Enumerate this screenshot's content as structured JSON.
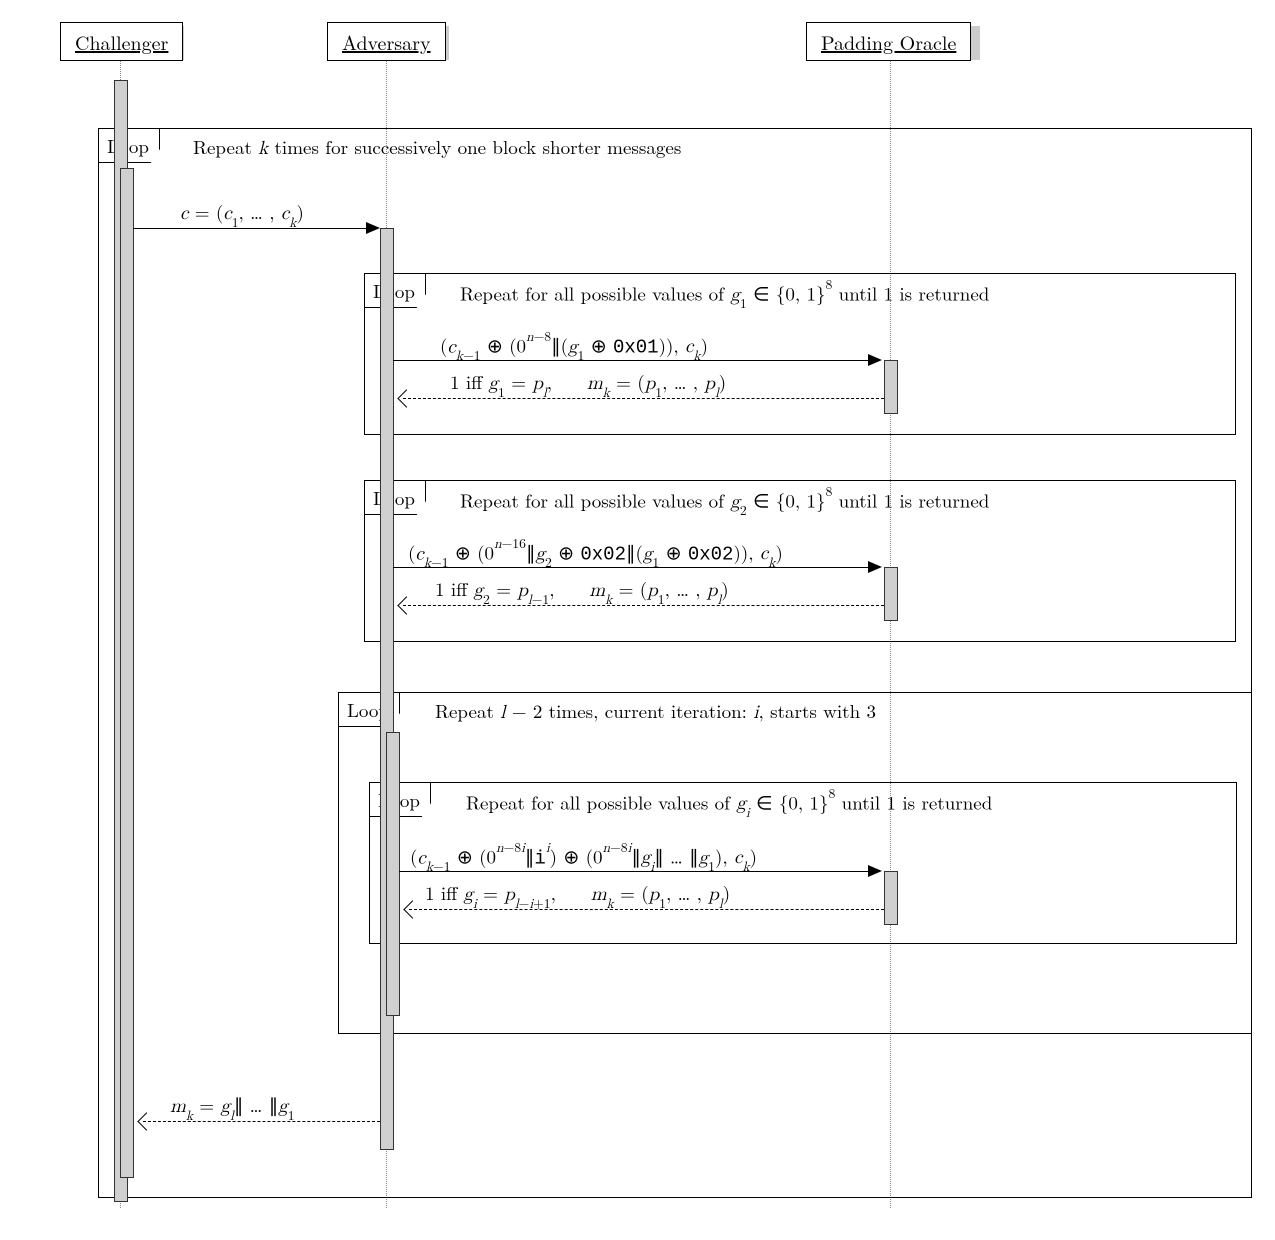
{
  "participants": {
    "challenger": "Challenger",
    "adversary": "Adversary",
    "oracle": "Padding Oracle"
  },
  "loops": {
    "outer": {
      "label": "Loop",
      "caption": "Repeat <span class='math'>k</span> times for successively one block shorter messages"
    },
    "g1": {
      "label": "Loop",
      "caption": "Repeat for all possible values of <span class='math'>g</span><sub>1</sub> ∈ {0, 1}<sup>8</sup> until 1 is returned"
    },
    "g2": {
      "label": "Loop",
      "caption": "Repeat for all possible values of <span class='math'>g</span><sub>2</sub> ∈ {0, 1}<sup>8</sup> until 1 is returned"
    },
    "lminus2": {
      "label": "Loop",
      "caption": "Repeat <span class='math'>l</span> − 2 times, current iteration: <span class='math'>i</span>, starts with 3"
    },
    "gi": {
      "label": "Loop",
      "caption": "Repeat for all possible values of <span class='math'>g<sub>i</sub></span> ∈ {0, 1}<sup>8</sup> until 1 is returned"
    }
  },
  "messages": {
    "ciphertext": "<span class='math'>c</span> = (<span class='math'>c</span><sub>1</sub>, … , <span class='math'>c<sub>k</sub></span>)",
    "g1_send": "(<span class='math'>c</span><sub><span class='math'>k</span>−1</sub> ⊕ (0<sup><span class='math'>n</span>−8</sup>∥(<span class='math'>g</span><sub>1</sub> ⊕ <span class='tt'>0x01</span>)), <span class='math'>c<sub>k</sub></span>)",
    "g1_resp": "1 iff <span class='math'>g</span><sub>1</sub> = <span class='math'>p<sub>l</sub></span>,&nbsp;&nbsp;&nbsp; <span class='math'>m<sub>k</sub></span> = (<span class='math'>p</span><sub>1</sub>, … , <span class='math'>p<sub>l</sub></span>)",
    "g2_send": "(<span class='math'>c</span><sub><span class='math'>k</span>−1</sub> ⊕ (0<sup><span class='math'>n</span>−16</sup>∥<span class='math'>g</span><sub>2</sub> ⊕ <span class='tt'>0x02</span>∥(<span class='math'>g</span><sub>1</sub> ⊕ <span class='tt'>0x02</span>)), <span class='math'>c<sub>k</sub></span>)",
    "g2_resp": "1 iff <span class='math'>g</span><sub>2</sub> = <span class='math'>p</span><sub><span class='math'>l</span>−1</sub>,&nbsp;&nbsp;&nbsp; <span class='math'>m<sub>k</sub></span> = (<span class='math'>p</span><sub>1</sub>, … , <span class='math'>p<sub>l</sub></span>)",
    "gi_send": "(<span class='math'>c</span><sub><span class='math'>k</span>−1</sub> ⊕ (0<sup><span class='math'>n</span>−8<span class='math'>i</span></sup>∥<span class='tt'>i</span><sup><span class='math'>i</span></sup>) ⊕ (0<sup><span class='math'>n</span>−8<span class='math'>i</span></sup>∥<span class='math'>g<sub>i</sub></span>∥ … ∥<span class='math'>g</span><sub>1</sub>), <span class='math'>c<sub>k</sub></span>)",
    "gi_resp": "1 iff <span class='math'>g<sub>i</sub></span> = <span class='math'>p</span><sub><span class='math'>l</span>−<span class='math'>i</span>+1</sub>,&nbsp;&nbsp;&nbsp; <span class='math'>m<sub>k</sub></span> = (<span class='math'>p</span><sub>1</sub>, … , <span class='math'>p<sub>l</sub></span>)",
    "final": "<span class='math'>m<sub>k</sub></span> = <span class='math'>g<sub>l</sub></span>∥ … ∥<span class='math'>g</span><sub>1</sub>"
  }
}
